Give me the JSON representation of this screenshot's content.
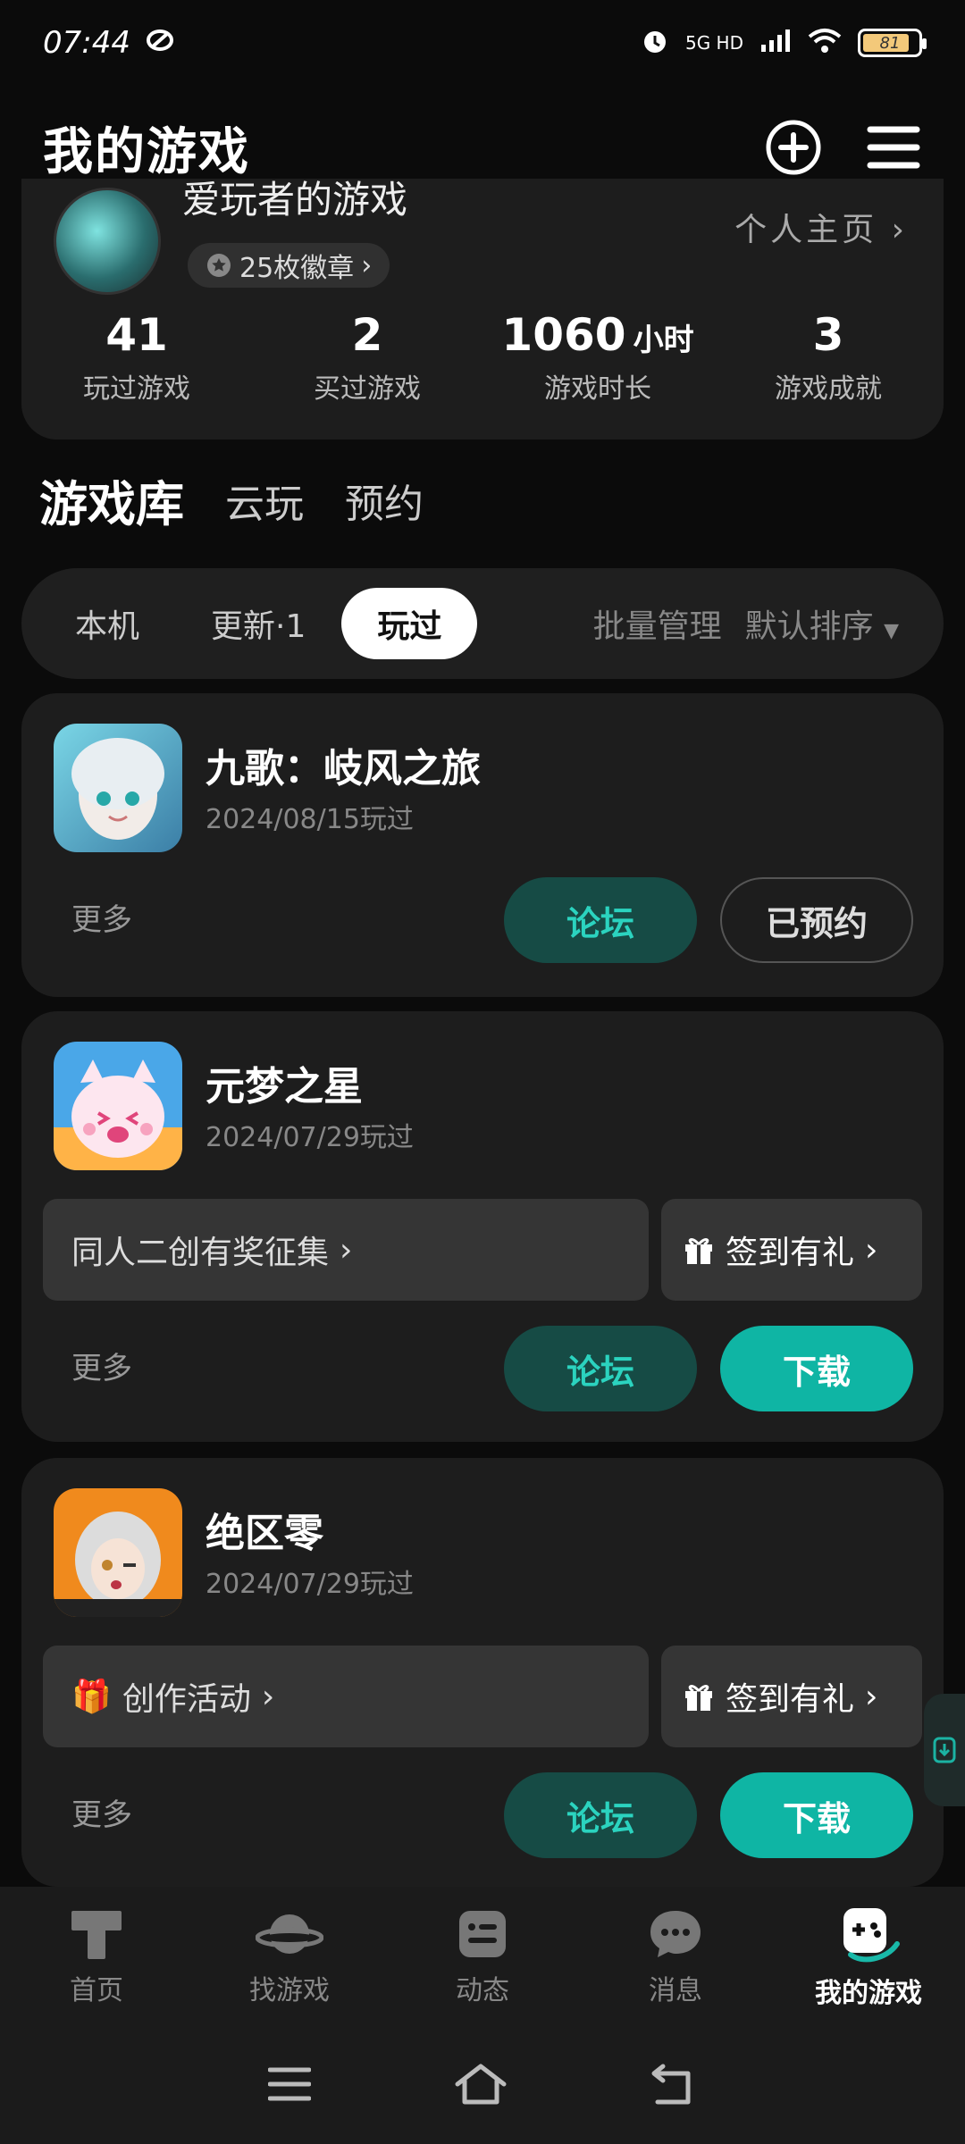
{
  "status_bar": {
    "time": "07:44",
    "network": "5G HD",
    "battery": "81"
  },
  "header": {
    "title": "我的游戏"
  },
  "profile": {
    "name": "爱玩者的游戏",
    "badges": "25枚徽章",
    "profile_link": "个人主页",
    "stats": [
      {
        "value": "41",
        "unit": "",
        "label": "玩过游戏"
      },
      {
        "value": "2",
        "unit": "",
        "label": "买过游戏"
      },
      {
        "value": "1060",
        "unit": "小时",
        "label": "游戏时长"
      },
      {
        "value": "3",
        "unit": "",
        "label": "游戏成就"
      }
    ]
  },
  "library_tabs": [
    "游戏库",
    "云玩",
    "预约"
  ],
  "filter": {
    "tabs": [
      "本机",
      "更新·1",
      "玩过"
    ],
    "batch": "批量管理",
    "sort": "默认排序"
  },
  "games": [
    {
      "title": "九歌：岐风之旅",
      "date": "2024/08/15玩过",
      "more": "更多",
      "forum": "论坛",
      "action": "已预约"
    },
    {
      "title": "元梦之星",
      "date": "2024/07/29玩过",
      "promo": "同人二创有奖征集",
      "checkin": "签到有礼",
      "more": "更多",
      "forum": "论坛",
      "action": "下载"
    },
    {
      "title": "绝区零",
      "date": "2024/07/29玩过",
      "promo": "创作活动",
      "checkin": "签到有礼",
      "more": "更多",
      "forum": "论坛",
      "action": "下载"
    }
  ],
  "bottom_nav": [
    "首页",
    "找游戏",
    "动态",
    "消息",
    "我的游戏"
  ],
  "colors": {
    "accent": "#0fb5a4",
    "forum_bg": "#164b45",
    "card_bg": "#1d1d1d"
  }
}
